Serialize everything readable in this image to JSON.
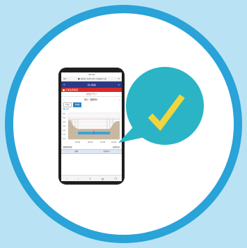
{
  "colors": {
    "background": "#b9e3f4",
    "ring": "#29a3d8",
    "disc": "#ffffff",
    "bubble": "#2ab4c6",
    "check": "#f2d53c",
    "header": "#2a3a86",
    "alert": "#d62a2a"
  },
  "phone": {
    "status_time": "10:10",
    "status_left": "",
    "status_right": "",
    "address_aa": "AA",
    "url": "www.rivercam.nagano.jp",
    "site_title": "河川情報",
    "alert_text": "氾濫注意情報",
    "panel_title": "水位グラフ",
    "station_name": "須川（長野市）",
    "tabs": [
      "10分",
      "1時間"
    ],
    "legend": "● 水位",
    "y_ticks": [
      "6.0",
      "5.0",
      "4.0",
      "3.0",
      "2.0",
      "1.0",
      "0.0"
    ],
    "x_ticks": [
      "00:00",
      "06:00",
      "12:00",
      "18:00"
    ],
    "info_left": "観測所情報",
    "info_right": "更新時刻",
    "table_head": [
      "日時",
      "水位(m)"
    ],
    "table_row": [
      "",
      ""
    ],
    "bottom_icons": [
      "back-icon",
      "forward-icon",
      "share-icon",
      "bookmarks-icon",
      "tabs-icon"
    ]
  },
  "icons": {
    "check": "check-mark-icon",
    "lock": "lock-icon",
    "reload": "reload-icon",
    "menu": "menu-icon"
  }
}
